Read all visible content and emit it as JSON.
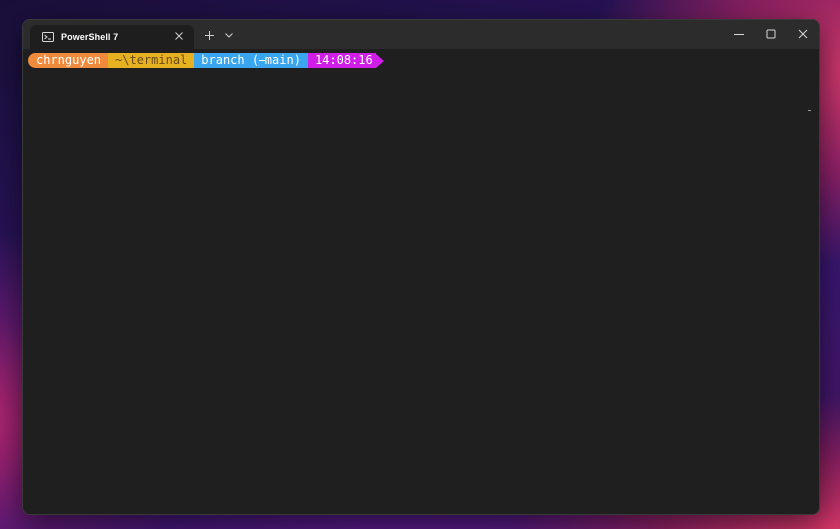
{
  "window": {
    "tab_title": "PowerShell 7",
    "tab_icon": "powershell-icon",
    "new_tab_icon": "plus-icon",
    "dropdown_icon": "chevron-down-icon"
  },
  "prompt": {
    "user": "chrngu​yen",
    "path": "~\\terminal",
    "git": "branch ( main)",
    "time": "14:08:16"
  },
  "colors": {
    "user_segment": "#f08a3c",
    "path_segment": "#e6b120",
    "git_segment": "#3aa6f0",
    "time_segment": "#d01ee8",
    "terminal_bg": "#1f1f1f",
    "titlebar_bg": "#2c2c2c"
  }
}
